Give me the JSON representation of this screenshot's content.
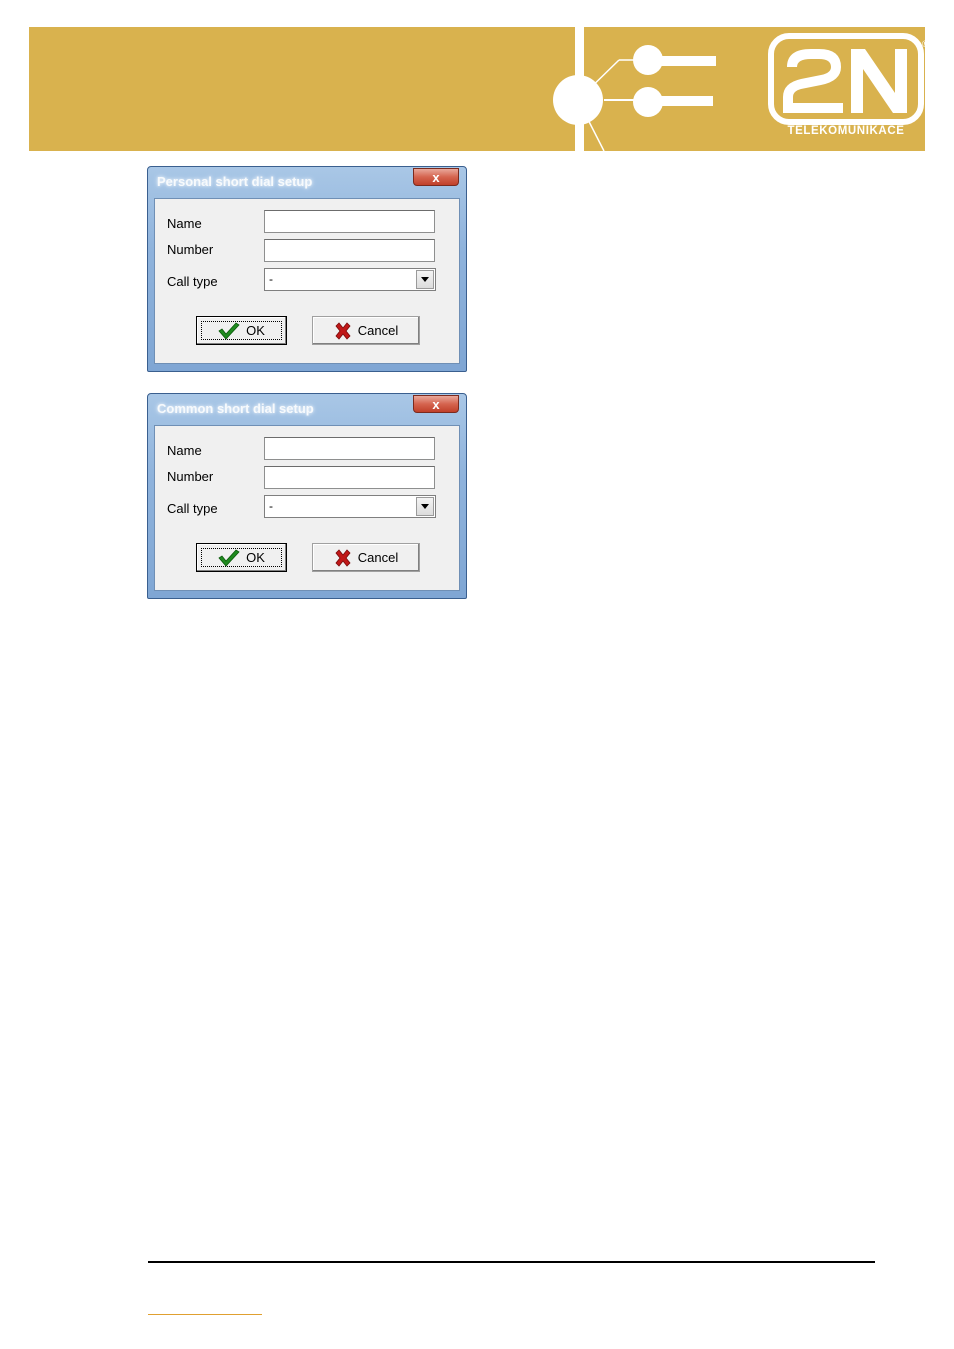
{
  "header": {
    "brand_logo": "2N",
    "brand_tagline": "TELEKOMUNIKACE",
    "brand_color": "#d9b24e"
  },
  "dialogs": [
    {
      "title": "Personal short dial setup",
      "close_glyph": "x",
      "fields": {
        "name_label": "Name",
        "name_value": "",
        "number_label": "Number",
        "number_value": "",
        "call_type_label": "Call type",
        "call_type_value": "-"
      },
      "ok_label": "OK",
      "cancel_label": "Cancel"
    },
    {
      "title": "Common short dial setup",
      "close_glyph": "x",
      "fields": {
        "name_label": "Name",
        "name_value": "",
        "number_label": "Number",
        "number_value": "",
        "call_type_label": "Call type",
        "call_type_value": "-"
      },
      "ok_label": "OK",
      "cancel_label": "Cancel"
    }
  ],
  "icons": {
    "ok": "checkmark-icon",
    "cancel": "x-mark-icon",
    "dropdown": "chevron-down-icon",
    "close": "close-icon"
  },
  "colors": {
    "ok_check": "#1f8a1f",
    "cancel_x": "#c01818",
    "close_button": "#c8503a"
  }
}
